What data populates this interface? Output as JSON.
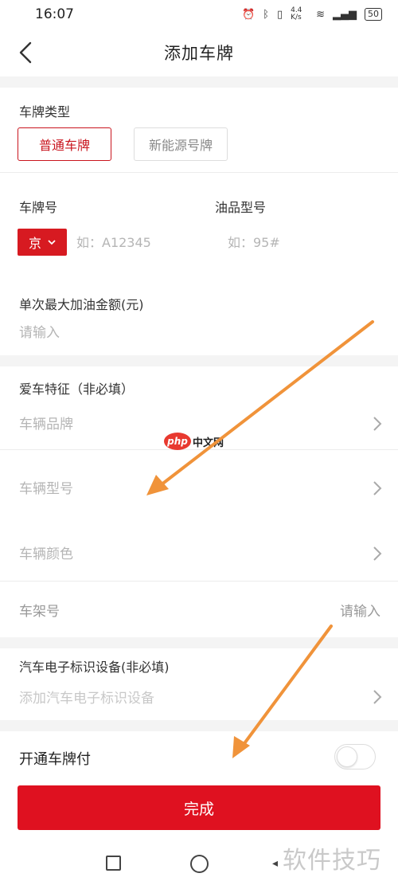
{
  "status_bar": {
    "time": "16:07",
    "network_speed": "4.4 K/s",
    "battery": "50"
  },
  "header": {
    "title": "添加车牌"
  },
  "plate_type": {
    "label": "车牌类型",
    "options": [
      "普通车牌",
      "新能源号牌"
    ],
    "selected": "普通车牌"
  },
  "plate_number": {
    "label": "车牌号",
    "province": "京",
    "placeholder": "如：A12345"
  },
  "fuel_type": {
    "label": "油品型号",
    "placeholder": "如：95#"
  },
  "max_amount": {
    "label": "单次最大加油金额(元)",
    "placeholder": "请输入"
  },
  "car_features": {
    "label": "爱车特征（非必填）",
    "brand": "车辆品牌",
    "model": "车辆型号",
    "color": "车辆颜色",
    "frame_label": "车架号",
    "frame_placeholder": "请输入"
  },
  "etc_device": {
    "label": "汽车电子标识设备(非必填)",
    "placeholder": "添加汽车电子标识设备"
  },
  "plate_pay": {
    "label": "开通车牌付",
    "enabled": false
  },
  "submit": {
    "label": "完成"
  },
  "watermarks": {
    "center_logo": "php",
    "center_text": "中文网",
    "corner_text": "软件技巧"
  },
  "colors": {
    "accent": "#df1120",
    "arrow": "#f0933a"
  }
}
